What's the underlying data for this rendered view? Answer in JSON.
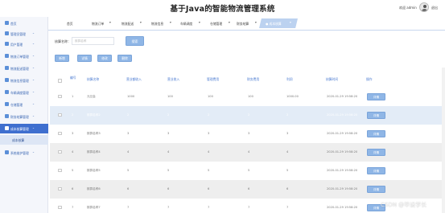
{
  "header": {
    "title": "基于Java的智能物流管理系统",
    "greeting": "欢迎 admin",
    "logout": "退出"
  },
  "sidebar": {
    "items": [
      {
        "label": "首页",
        "chevron": ""
      },
      {
        "label": "管理员管理",
        "chevron": "⌄"
      },
      {
        "label": "用户管理",
        "chevron": "⌄"
      },
      {
        "label": "物流订单管理",
        "chevron": "⌄"
      },
      {
        "label": "物流配送管理",
        "chevron": "⌄"
      },
      {
        "label": "物流信息管理",
        "chevron": "⌄"
      },
      {
        "label": "车辆调度管理",
        "chevron": "⌄"
      },
      {
        "label": "仓储管理",
        "chevron": "⌄"
      },
      {
        "label": "财务结算管理",
        "chevron": "⌄"
      },
      {
        "label": "成本核算管理",
        "chevron": "⌄"
      },
      {
        "label": "系统管理",
        "chevron": "⌄"
      }
    ],
    "active_index": 9,
    "sub_item": "成本核算",
    "last_item": "系统维护管理"
  },
  "nav": {
    "tabs": [
      {
        "label": "首页",
        "arrow": ""
      },
      {
        "label": "物流订单",
        "arrow": "▾"
      },
      {
        "label": "物流配送",
        "arrow": "▾"
      },
      {
        "label": "物流信息",
        "arrow": "▾"
      },
      {
        "label": "车辆调度",
        "arrow": "▾"
      },
      {
        "label": "仓储管理",
        "arrow": "▾"
      },
      {
        "label": "财务结算",
        "arrow": "▾"
      },
      {
        "label": "● 成本核算",
        "arrow": "▾"
      }
    ]
  },
  "search": {
    "label": "核算名称：",
    "placeholder": "核算名称",
    "button": "搜索"
  },
  "actions": {
    "add": "新增",
    "detail": "详情",
    "edit": "修改",
    "delete": "删除"
  },
  "table": {
    "columns": [
      "编号",
      "核算名称",
      "营业额收入",
      "营业收入",
      "管理费用",
      "财务费用",
      "利润",
      "核算时间",
      "操作"
    ],
    "rows": [
      {
        "id": "1",
        "name": "元旦会",
        "c1": "1000",
        "c2": "100",
        "c3": "100",
        "c4": "100",
        "profit": "1000.00",
        "time": "2020-01-29 19:58:20",
        "op": "详情"
      },
      {
        "id": "2",
        "name": "核算名称2",
        "c1": "2",
        "c2": "2",
        "c3": "2",
        "c4": "2",
        "profit": "2",
        "time": "2020-01-29 19:58:20",
        "op": "详情"
      },
      {
        "id": "3",
        "name": "核算名称3",
        "c1": "3",
        "c2": "3",
        "c3": "3",
        "c4": "3",
        "profit": "3",
        "time": "2020-01-29 19:58:20",
        "op": "详情"
      },
      {
        "id": "4",
        "name": "核算名称4",
        "c1": "4",
        "c2": "4",
        "c3": "4",
        "c4": "4",
        "profit": "4",
        "time": "2020-01-29 19:58:20",
        "op": "详情"
      },
      {
        "id": "5",
        "name": "核算名称5",
        "c1": "5",
        "c2": "5",
        "c3": "5",
        "c4": "5",
        "profit": "5",
        "time": "2020-01-29 19:58:20",
        "op": "详情"
      },
      {
        "id": "6",
        "name": "核算名称6",
        "c1": "6",
        "c2": "6",
        "c3": "6",
        "c4": "6",
        "profit": "6",
        "time": "2020-01-29 19:58:20",
        "op": "详情"
      },
      {
        "id": "7",
        "name": "核算名称7",
        "c1": "7",
        "c2": "7",
        "c3": "7",
        "c4": "7",
        "profit": "7",
        "time": "2020-01-29 19:58:20",
        "op": "详情"
      }
    ]
  },
  "watermark": "CSDN @毕设学长"
}
